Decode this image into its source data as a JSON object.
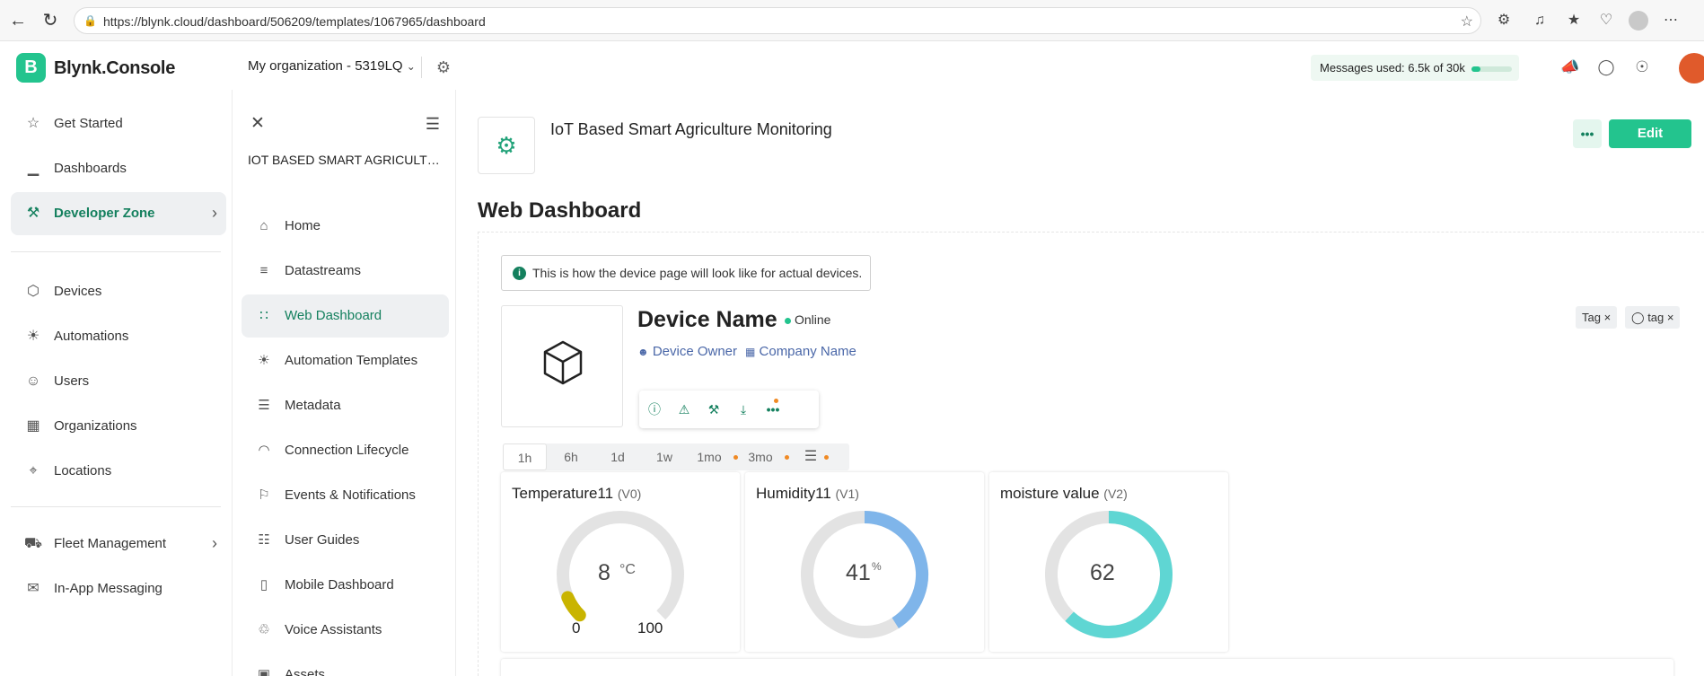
{
  "browser": {
    "url": "https://blynk.cloud/dashboard/506209/templates/1067965/dashboard",
    "icons": [
      "back-arrow-icon",
      "refresh-icon",
      "lock-icon",
      "star-icon",
      "extensions-icon",
      "read-aloud-icon",
      "favorites-icon",
      "health-icon",
      "profile-icon",
      "more-icon"
    ]
  },
  "app": {
    "logo_letter": "B",
    "name": "Blynk.Console",
    "org_selector": "My organization - 5319LQ",
    "messages_used": "Messages used: 6.5k of 30k",
    "messages_fraction": 0.22,
    "brand_color": "#23c48e"
  },
  "left_nav": {
    "items": [
      {
        "label": "Get Started",
        "icon": "star-icon"
      },
      {
        "label": "Dashboards",
        "icon": "bar-chart-icon"
      },
      {
        "label": "Developer Zone",
        "icon": "tools-icon",
        "active": true
      },
      {
        "label": "Devices",
        "icon": "cube-icon"
      },
      {
        "label": "Automations",
        "icon": "automation-icon"
      },
      {
        "label": "Users",
        "icon": "users-icon"
      },
      {
        "label": "Organizations",
        "icon": "building-icon"
      },
      {
        "label": "Locations",
        "icon": "location-pin-icon"
      },
      {
        "label": "Fleet Management",
        "icon": "truck-icon"
      },
      {
        "label": "In-App Messaging",
        "icon": "messaging-icon"
      }
    ]
  },
  "template_nav": {
    "template_name": "IOT BASED SMART AGRICULTU...",
    "items": [
      {
        "label": "Home",
        "icon": "home-icon"
      },
      {
        "label": "Datastreams",
        "icon": "datastreams-icon"
      },
      {
        "label": "Web Dashboard",
        "icon": "grid-icon",
        "active": true
      },
      {
        "label": "Automation Templates",
        "icon": "automation-icon"
      },
      {
        "label": "Metadata",
        "icon": "list-icon"
      },
      {
        "label": "Connection Lifecycle",
        "icon": "wifi-icon"
      },
      {
        "label": "Events & Notifications",
        "icon": "bell-icon"
      },
      {
        "label": "User Guides",
        "icon": "book-icon"
      },
      {
        "label": "Mobile Dashboard",
        "icon": "mobile-icon"
      },
      {
        "label": "Voice Assistants",
        "icon": "microphone-icon"
      },
      {
        "label": "Assets",
        "icon": "assets-icon"
      }
    ]
  },
  "main": {
    "template_title": "IoT Based Smart Agriculture Monitoring",
    "edit_label": "Edit",
    "heading": "Web Dashboard",
    "info_banner": "This is how the device page will look like for actual devices.",
    "device": {
      "name": "Device Name",
      "status": "Online",
      "owner": "Device Owner",
      "company": "Company Name"
    },
    "tags": [
      {
        "label": "Tag",
        "icon": ""
      },
      {
        "label": "tag",
        "icon": "tag-icon"
      }
    ],
    "time_ranges": [
      "1h",
      "6h",
      "1d",
      "1w",
      "1mo",
      "3mo"
    ],
    "selected_range": "1h",
    "widgets": [
      {
        "title": "Temperature11",
        "pin": "(V0)",
        "value": "8",
        "unit": "°C",
        "min": "0",
        "max": "100",
        "fraction": 0.08,
        "color": "#c9b400",
        "type": "gauge"
      },
      {
        "title": "Humidity11",
        "pin": "(V1)",
        "value": "41",
        "unit": "%",
        "fraction": 0.41,
        "color": "#7fb5ea",
        "type": "ring"
      },
      {
        "title": "moisture value",
        "pin": "(V2)",
        "value": "62",
        "unit": "",
        "fraction": 0.62,
        "color": "#5fd6d3",
        "type": "ring"
      }
    ]
  }
}
